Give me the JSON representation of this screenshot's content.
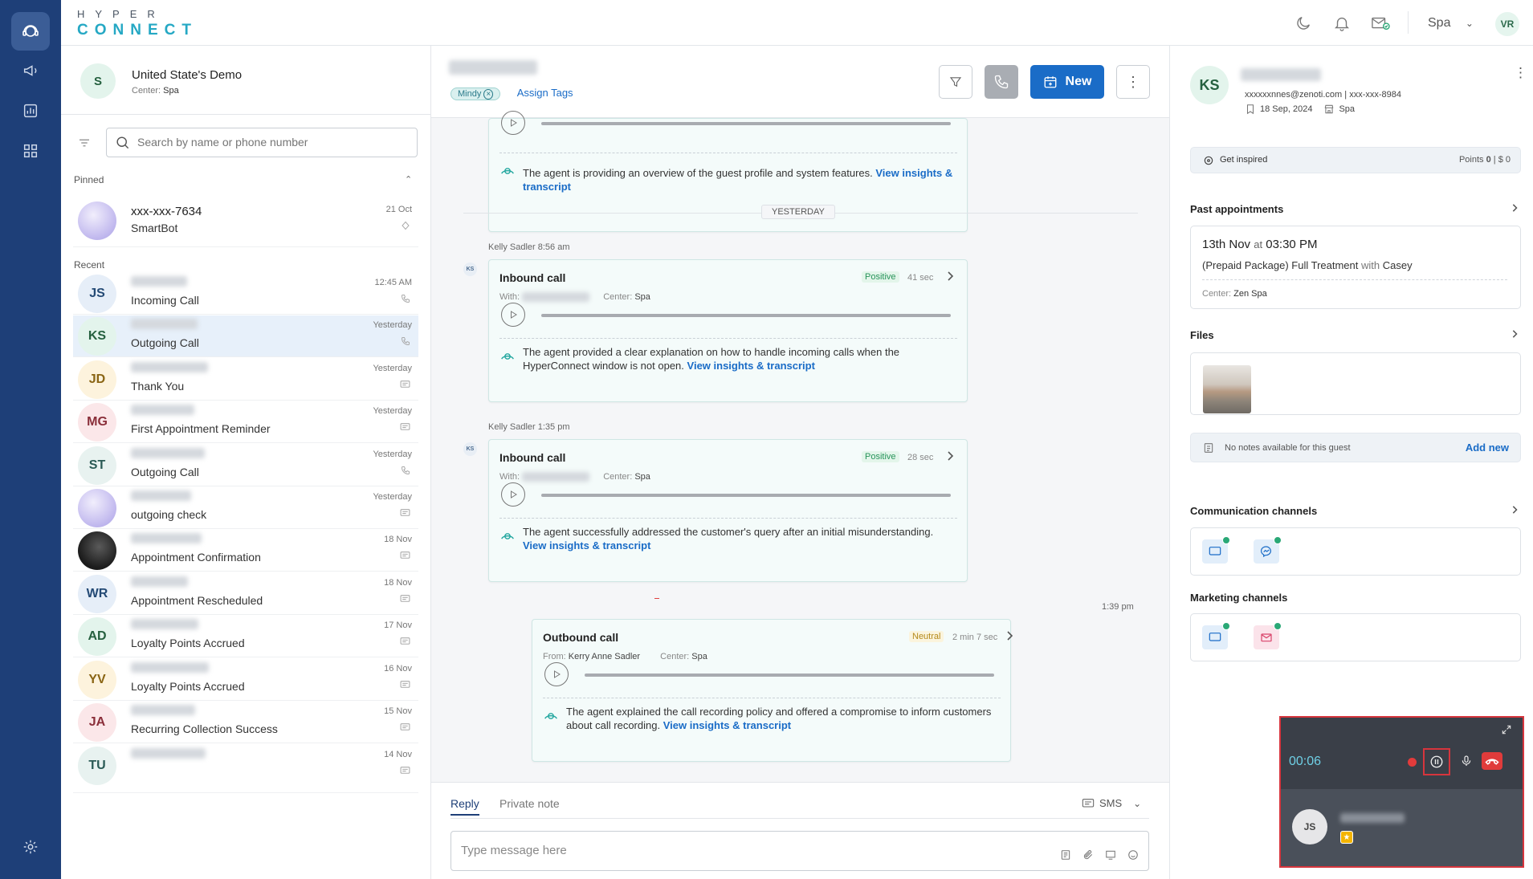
{
  "app": {
    "logo_top": "HYPER",
    "logo_bottom": "CONNECT"
  },
  "topbar": {
    "center": "Spa",
    "user_initials": "VR"
  },
  "account": {
    "initial": "S",
    "name": "United State's Demo",
    "center_label": "Center:",
    "center_value": "Spa"
  },
  "search": {
    "placeholder": "Search by name or phone number"
  },
  "pinned": {
    "label": "Pinned",
    "item": {
      "name": "xxx-xxx-7634",
      "sub": "SmartBot",
      "time": "21 Oct"
    }
  },
  "recent": {
    "label": "Recent",
    "items": [
      {
        "initials": "JS",
        "sub": "Incoming Call",
        "time": "12:45 AM",
        "icon": "phone-icon",
        "bg": "#e6eef8",
        "fg": "#244a75"
      },
      {
        "initials": "KS",
        "sub": "Outgoing Call",
        "time": "Yesterday",
        "icon": "phone-icon",
        "bg": "#e3f4ec",
        "fg": "#25603f"
      },
      {
        "initials": "JD",
        "sub": "Thank You",
        "time": "Yesterday",
        "icon": "message-icon",
        "bg": "#fdf3dd",
        "fg": "#8a6514"
      },
      {
        "initials": "MG",
        "sub": "First Appointment Reminder",
        "time": "Yesterday",
        "icon": "message-icon",
        "bg": "#fbe7e9",
        "fg": "#8a2f3a"
      },
      {
        "initials": "ST",
        "sub": "Outgoing Call",
        "time": "Yesterday",
        "icon": "phone-icon",
        "bg": "#e8f2f0",
        "fg": "#2a5a55"
      },
      {
        "initials": "",
        "sub": "outgoing check",
        "time": "Yesterday",
        "icon": "message-icon",
        "bg": "#d9d6f2",
        "fg": "#fff"
      },
      {
        "initials": "",
        "sub": "Appointment Confirmation",
        "time": "18 Nov",
        "icon": "message-icon",
        "bg": "#3a3a3a",
        "fg": "#fff"
      },
      {
        "initials": "WR",
        "sub": "Appointment Rescheduled",
        "time": "18 Nov",
        "icon": "message-icon",
        "bg": "#e6eef8",
        "fg": "#244a75"
      },
      {
        "initials": "AD",
        "sub": "Loyalty Points Accrued",
        "time": "17 Nov",
        "icon": "message-icon",
        "bg": "#e3f4ec",
        "fg": "#25603f"
      },
      {
        "initials": "YV",
        "sub": "Loyalty Points Accrued",
        "time": "16 Nov",
        "icon": "message-icon",
        "bg": "#fdf3dd",
        "fg": "#8a6514"
      },
      {
        "initials": "JA",
        "sub": "Recurring Collection Success",
        "time": "15 Nov",
        "icon": "message-icon",
        "bg": "#fbe7e9",
        "fg": "#8a2f3a"
      },
      {
        "initials": "TU",
        "sub": "",
        "time": "14 Nov",
        "icon": "message-icon",
        "bg": "#e8f2f0",
        "fg": "#2a5a55"
      }
    ]
  },
  "chat": {
    "tag": "Mindy",
    "assign_tags": "Assign Tags",
    "new_button": "New",
    "top_card": {
      "desc": "The agent is providing an overview of the guest profile and system features.",
      "link": "View insights & transcript"
    },
    "divider": "YESTERDAY",
    "calls": [
      {
        "meta": "Kelly Sadler  8:56 am",
        "avatar": "KS",
        "title": "Inbound call",
        "sentiment": "Positive",
        "duration": "41 sec",
        "with_label": "With:",
        "center_label": "Center:",
        "center": "Spa",
        "desc": "The agent provided a clear explanation on how to handle incoming calls when the HyperConnect window is not open.",
        "link": "View insights & transcript"
      },
      {
        "meta": "Kelly Sadler  1:35 pm",
        "avatar": "KS",
        "title": "Inbound call",
        "sentiment": "Positive",
        "duration": "28 sec",
        "with_label": "With:",
        "center_label": "Center:",
        "center": "Spa",
        "desc": "The agent successfully addressed the customer's query after an initial misunderstanding.",
        "link": "View insights & transcript"
      },
      {
        "meta": "1:39 pm",
        "title": "Outbound call",
        "sentiment": "Neutral",
        "duration": "2 min 7 sec",
        "from_label": "From:",
        "from": "Kerry Anne Sadler",
        "center_label": "Center:",
        "center": "Spa",
        "desc": "The agent explained the call recording policy and offered a compromise to inform customers about call recording.",
        "link": "View insights & transcript"
      }
    ],
    "composer": {
      "tab_reply": "Reply",
      "tab_note": "Private note",
      "channel": "SMS",
      "placeholder": "Type message here"
    }
  },
  "guest": {
    "initials": "KS",
    "email": "xxxxxxnnes@zenoti.com",
    "phone": "| xxx-xxx-8984",
    "date": "18 Sep, 2024",
    "center": "Spa",
    "inspired": "Get inspired",
    "points_label": "Points",
    "points": "0",
    "money": "| $ 0",
    "past_appointments": "Past appointments",
    "appt": {
      "date": "13th Nov",
      "at": "at",
      "time": "03:30 PM",
      "service": "(Prepaid Package) Full Treatment",
      "with": "with",
      "provider": "Casey",
      "center_label": "Center:",
      "center": "Zen Spa"
    },
    "files": "Files",
    "notes_empty": "No notes available for this guest",
    "add_new": "Add new",
    "communication_channels": "Communication channels",
    "marketing_channels": "Marketing channels"
  },
  "call_widget": {
    "timer": "00:06",
    "caller_initials": "JS"
  },
  "colors": {
    "rail": "#1e3f78",
    "accent": "#1a6cc7",
    "teal": "#25a8c4",
    "end_call": "#e03b3b"
  }
}
